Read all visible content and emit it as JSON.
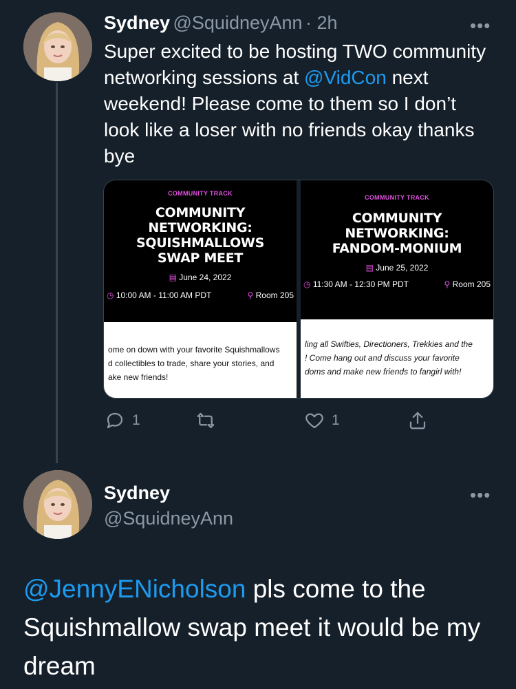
{
  "tweet1": {
    "name": "Sydney",
    "handle": "@SquidneyAnn",
    "time": "· 2h",
    "more": "•••",
    "text_before": "Super excited to be hosting TWO community networking sessions at",
    "mention": "@VidCon",
    "text_after": " next weekend! Please come to them so I don’t look like a loser with no friends okay thanks bye",
    "reply_count": "1",
    "like_count": "1",
    "cards": [
      {
        "track": "COMMUNITY TRACK",
        "title_lines": [
          "COMMUNITY",
          "NETWORKING:",
          "SQUISHMALLOWS",
          "SWAP MEET"
        ],
        "date": "June 24, 2022",
        "time": "10:00 AM - 11:00 AM PDT",
        "room": "Room 205",
        "desc_lines": [
          "ome on down with your favorite Squishmallows",
          "d collectibles to trade, share your stories, and",
          "ake new friends!"
        ]
      },
      {
        "track": "COMMUNITY TRACK",
        "title_lines": [
          "COMMUNITY",
          "NETWORKING:",
          "FANDOM-MONIUM"
        ],
        "date": "June 25, 2022",
        "time": "11:30 AM - 12:30 PM PDT",
        "room": "Room 205",
        "desc_lines": [
          "ling all Swifties, Directioners, Trekkies and the",
          "! Come hang out and discuss your favorite",
          "doms and make new friends to fangirl with!"
        ]
      }
    ]
  },
  "tweet2": {
    "name": "Sydney",
    "handle": "@SquidneyAnn",
    "more": "•••",
    "mention": "@JennyENicholson",
    "text": " pls come to the Squishmallow swap meet it would be my dream"
  }
}
